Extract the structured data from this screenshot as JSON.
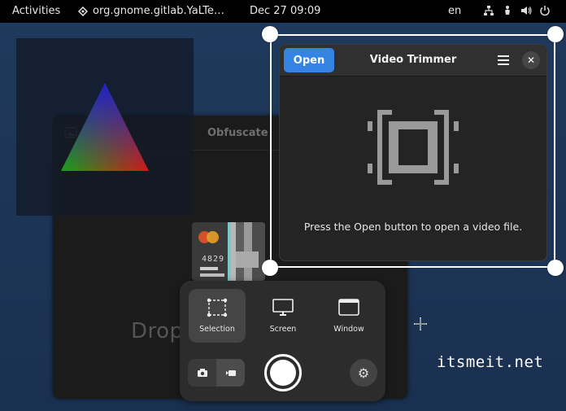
{
  "topbar": {
    "activities": "Activities",
    "app_name": "org.gnome.gitlab.YaLTe…",
    "clock": "Dec 27  09:09",
    "language": "en",
    "tray_icons": [
      "network-icon",
      "accessibility-icon",
      "volume-icon",
      "power-icon"
    ]
  },
  "obfuscate": {
    "title": "Obfuscate",
    "drop_text": "Drop",
    "card_number": "4829"
  },
  "video_trimmer": {
    "open_label": "Open",
    "title": "Video Trimmer",
    "message": "Press the Open button to open a video file."
  },
  "screenshot_ui": {
    "modes": [
      {
        "label": "Selection",
        "selected": true
      },
      {
        "label": "Screen",
        "selected": false
      },
      {
        "label": "Window",
        "selected": false
      }
    ]
  },
  "watermark": "itsmeit.net",
  "colors": {
    "accent": "#3584e4",
    "desktop": "#1f3a5c",
    "panel": "#2c2c2c"
  }
}
